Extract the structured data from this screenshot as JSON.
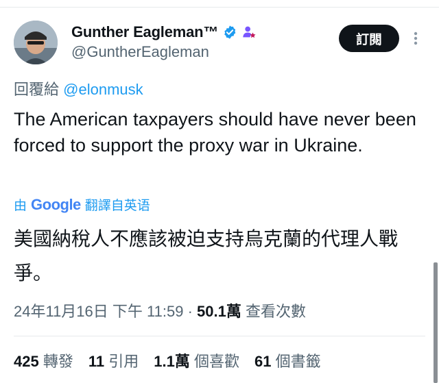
{
  "author": {
    "display_name": "Gunther Eagleman™",
    "handle": "@GuntherEagleman"
  },
  "subscribe_label": "訂閱",
  "reply": {
    "prefix": "回覆給",
    "mention": "@elonmusk"
  },
  "tweet_text": "The American taxpayers should have never been forced to support the proxy war in Ukraine.",
  "translation": {
    "by": "由",
    "google": "Google",
    "label": "翻譯自英语",
    "text": "美國納稅人不應該被迫支持烏克蘭的代理人戰爭。"
  },
  "meta": {
    "datetime": "24年11月16日 下午 11:59",
    "separator": "·",
    "views_count": "50.1萬",
    "views_label": "查看次數"
  },
  "stats": [
    {
      "count": "425",
      "label": "轉發"
    },
    {
      "count": "11",
      "label": "引用"
    },
    {
      "count": "1.1萬",
      "label": "個喜歡"
    },
    {
      "count": "61",
      "label": "個書籤"
    }
  ],
  "colors": {
    "accent": "#1d9bf0",
    "text": "#0f1419",
    "muted": "#536471",
    "button": "#0f1419",
    "affiliate_badge": "#7856ff"
  },
  "icons": [
    "verified-badge-icon",
    "affiliate-badge-icon",
    "more-options-icon"
  ]
}
